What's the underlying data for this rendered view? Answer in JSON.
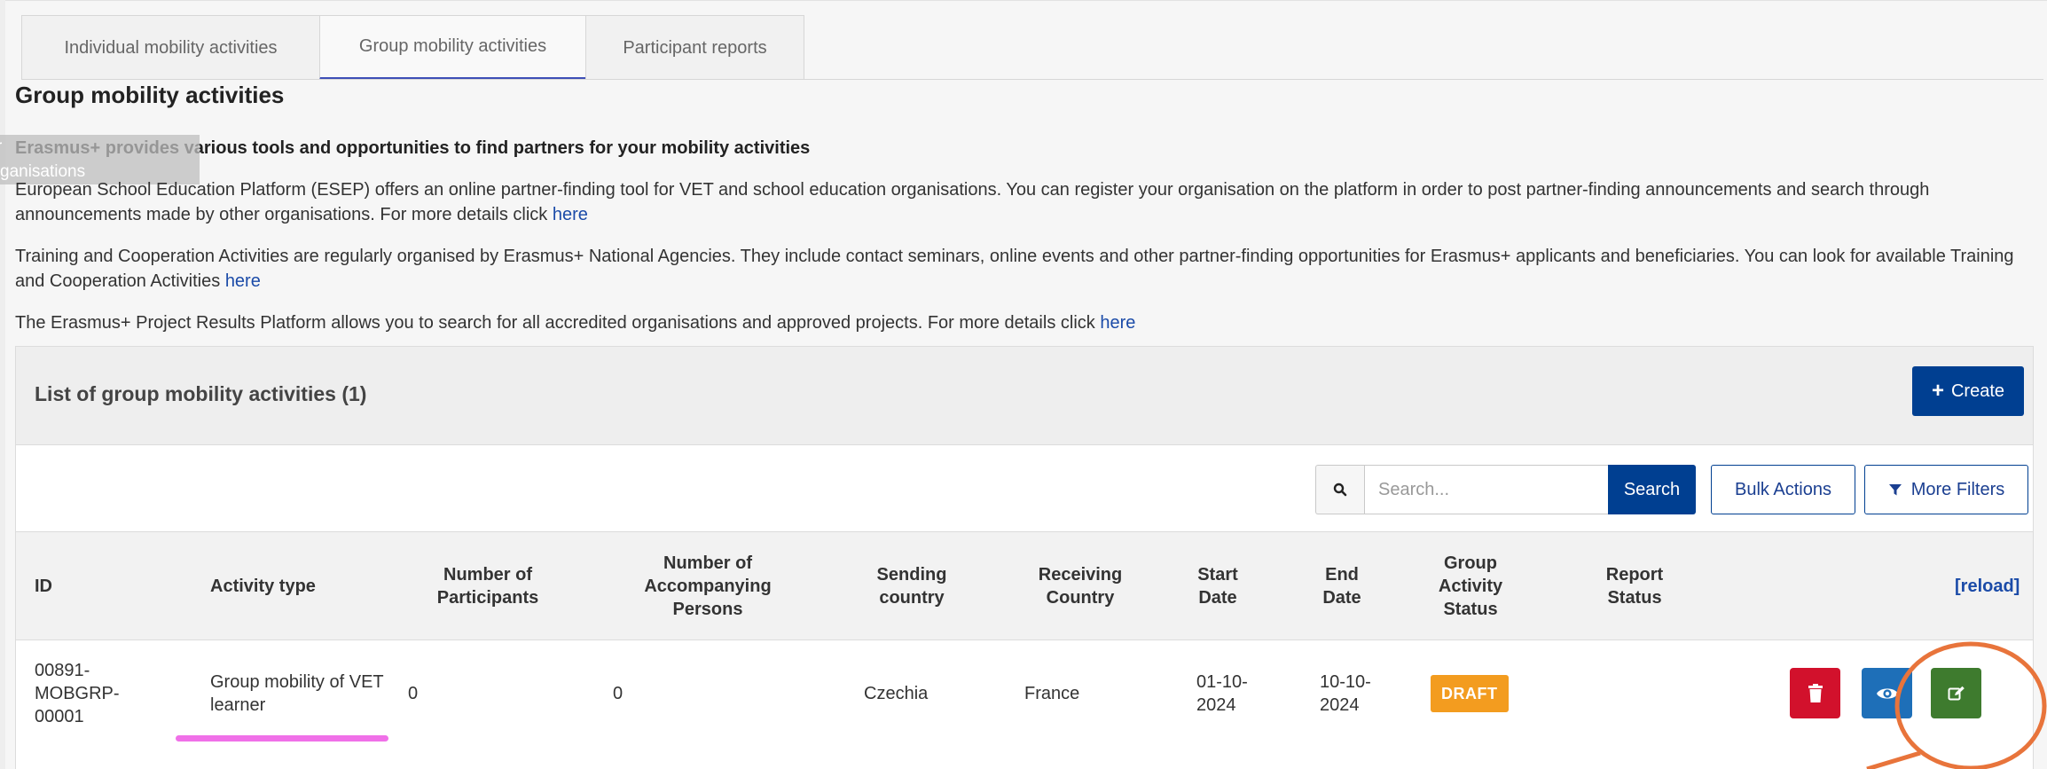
{
  "tabs": [
    {
      "label": "Individual mobility activities"
    },
    {
      "label": "Group mobility activities"
    },
    {
      "label": "Participant reports"
    }
  ],
  "page_title": "Group mobility activities",
  "overlay_text": [
    "r",
    "ganisations"
  ],
  "partners": {
    "heading": "Erasmus+ provides various tools and opportunities to find partners for your mobility activities",
    "p1_text": "European School Education Platform (ESEP) offers an online partner-finding tool for VET and school education organisations. You can register your organisation on the platform in order to post partner-finding announcements and search through announcements made by other organisations. For more details click ",
    "p1_link": "here",
    "p2_text": "Training and Cooperation Activities are regularly organised by Erasmus+ National Agencies. They include contact seminars, online events and other partner-finding opportunities for Erasmus+ applicants and beneficiaries. You can look for available Training and Cooperation Activities ",
    "p2_link": "here",
    "p3_text": "The Erasmus+ Project Results Platform allows you to search for all accredited organisations and approved projects. For more details click ",
    "p3_link": "here"
  },
  "list": {
    "title": "List of group mobility activities (1)",
    "create_label": "Create",
    "search_placeholder": "Search...",
    "search_label": "Search",
    "bulk_label": "Bulk Actions",
    "filters_label": "More Filters",
    "columns": {
      "id": "ID",
      "activity_type": "Activity type",
      "participants": "Number of Participants",
      "accompanying": "Number of Accompanying Persons",
      "sending": "Sending country",
      "receiving": "Receiving Country",
      "start": "Start Date",
      "end": "End Date",
      "group_status": "Group Activity Status",
      "report_status": "Report Status",
      "reload": "[reload]"
    },
    "rows": [
      {
        "id": "00891-MOBGRP-00001",
        "activity_type": "Group mobility of VET learner",
        "participants": "0",
        "accompanying": "0",
        "sending": "Czechia",
        "receiving": "France",
        "start": "01-10-2024",
        "end": "10-10-2024",
        "status": "DRAFT",
        "report_status": ""
      }
    ]
  },
  "icons": {
    "create": "plus-icon",
    "search": "search-icon",
    "filter": "filter-icon",
    "delete": "trash-icon",
    "view": "eye-icon",
    "edit": "edit-icon"
  },
  "colors": {
    "primary": "#003f91",
    "delete": "#d2112c",
    "view": "#1e6fb8",
    "edit": "#3e7b2e",
    "draft": "#f39c1f",
    "annotation_circle": "#e8743b",
    "annotation_underline": "#f070e8"
  }
}
